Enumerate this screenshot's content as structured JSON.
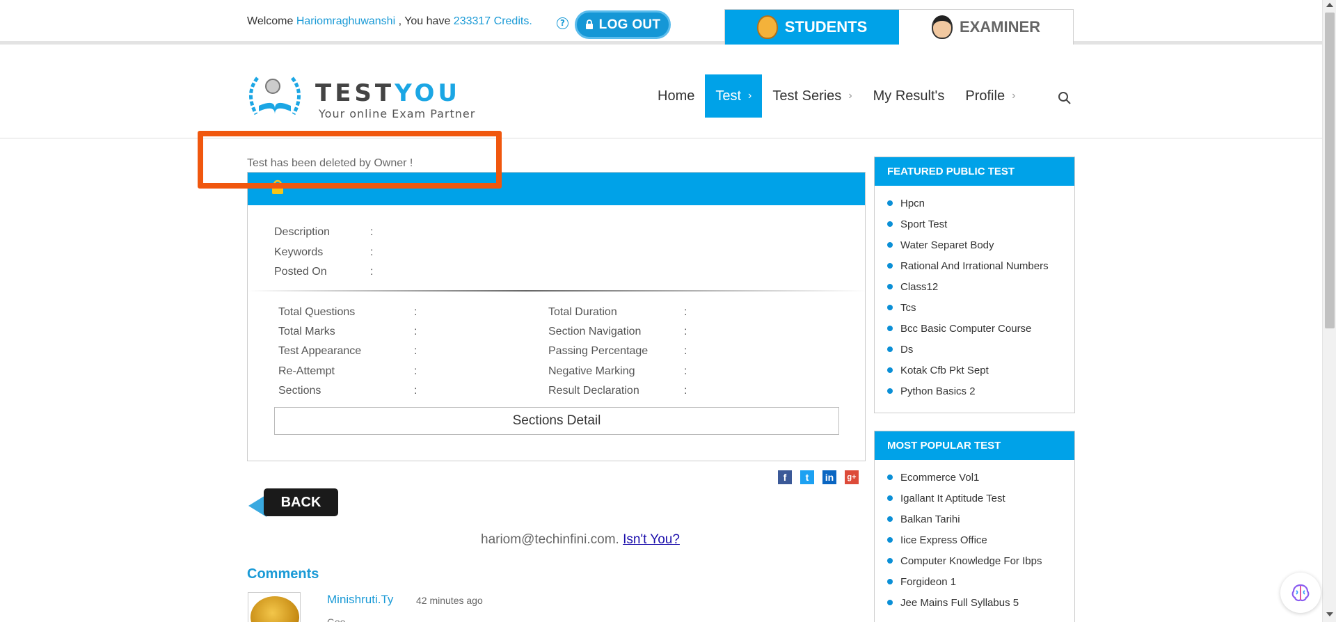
{
  "topbar": {
    "welcome_prefix": "Welcome",
    "username": "Hariomraghuwanshi",
    "have_text": ", You have",
    "credits": "233317 Credits",
    "credits_suffix": ".",
    "logout_label": "LOG OUT",
    "roles": [
      {
        "label": "STUDENTS",
        "icon": "student-face-icon",
        "active": true
      },
      {
        "label": "EXAMINER",
        "icon": "examiner-face-icon",
        "active": false
      }
    ]
  },
  "logo": {
    "brand_a": "TEST",
    "brand_b": "YOU",
    "tagline": "Your online Exam Partner"
  },
  "nav": {
    "items": [
      {
        "label": "Home",
        "chevron": ""
      },
      {
        "label": "Test",
        "chevron": "›"
      },
      {
        "label": "Test Series",
        "chevron": "›"
      },
      {
        "label": "My Result's",
        "chevron": ""
      },
      {
        "label": "Profile",
        "chevron": "›"
      }
    ]
  },
  "main": {
    "deleted_message": "Test has been deleted by Owner !",
    "meta": [
      {
        "key": "Description",
        "sep": ":"
      },
      {
        "key": "Keywords",
        "sep": ":"
      },
      {
        "key": "Posted On",
        "sep": ":"
      }
    ],
    "stats": [
      {
        "key": "Total Questions",
        "sep": ":"
      },
      {
        "key": "Total Duration",
        "sep": ":"
      },
      {
        "key": "Total Marks",
        "sep": ":"
      },
      {
        "key": "Section Navigation",
        "sep": ":"
      },
      {
        "key": "Test Appearance",
        "sep": ":"
      },
      {
        "key": "Passing Percentage",
        "sep": ":"
      },
      {
        "key": "Re-Attempt",
        "sep": ":"
      },
      {
        "key": "Negative Marking",
        "sep": ":"
      },
      {
        "key": "Sections",
        "sep": ":"
      },
      {
        "key": "Result Declaration",
        "sep": ":"
      }
    ],
    "sections_detail_label": "Sections Detail",
    "social": {
      "facebook": "f",
      "twitter": "t",
      "linkedin": "in",
      "googleplus": "g+"
    },
    "back_label": "BACK",
    "email": "hariom@techinfini.com.",
    "not_you_link": "Isn't You?",
    "comments_title": "Comments",
    "comment": {
      "user": "Minishruti.Ty",
      "time": "42 minutes ago",
      "text": "Goo..."
    }
  },
  "sidebar": {
    "featured": {
      "title": "FEATURED PUBLIC TEST",
      "items": [
        "Hpcn",
        "Sport Test",
        "Water Separet Body",
        "Rational And Irrational Numbers",
        "Class12",
        "Tcs",
        "Bcc Basic Computer Course",
        "Ds",
        "Kotak Cfb Pkt Sept",
        "Python Basics 2"
      ]
    },
    "popular": {
      "title": "MOST POPULAR TEST",
      "items": [
        "Ecommerce Vol1",
        "Igallant It Aptitude Test",
        "Balkan Tarihi",
        "Iice Express Office",
        "Computer Knowledge For Ibps",
        "Forgideon 1",
        "Jee Mains Full Syllabus 5"
      ]
    }
  },
  "colors": {
    "accent": "#00a2e8",
    "highlight_box": "#f0570e",
    "link": "#1a9ad6"
  }
}
